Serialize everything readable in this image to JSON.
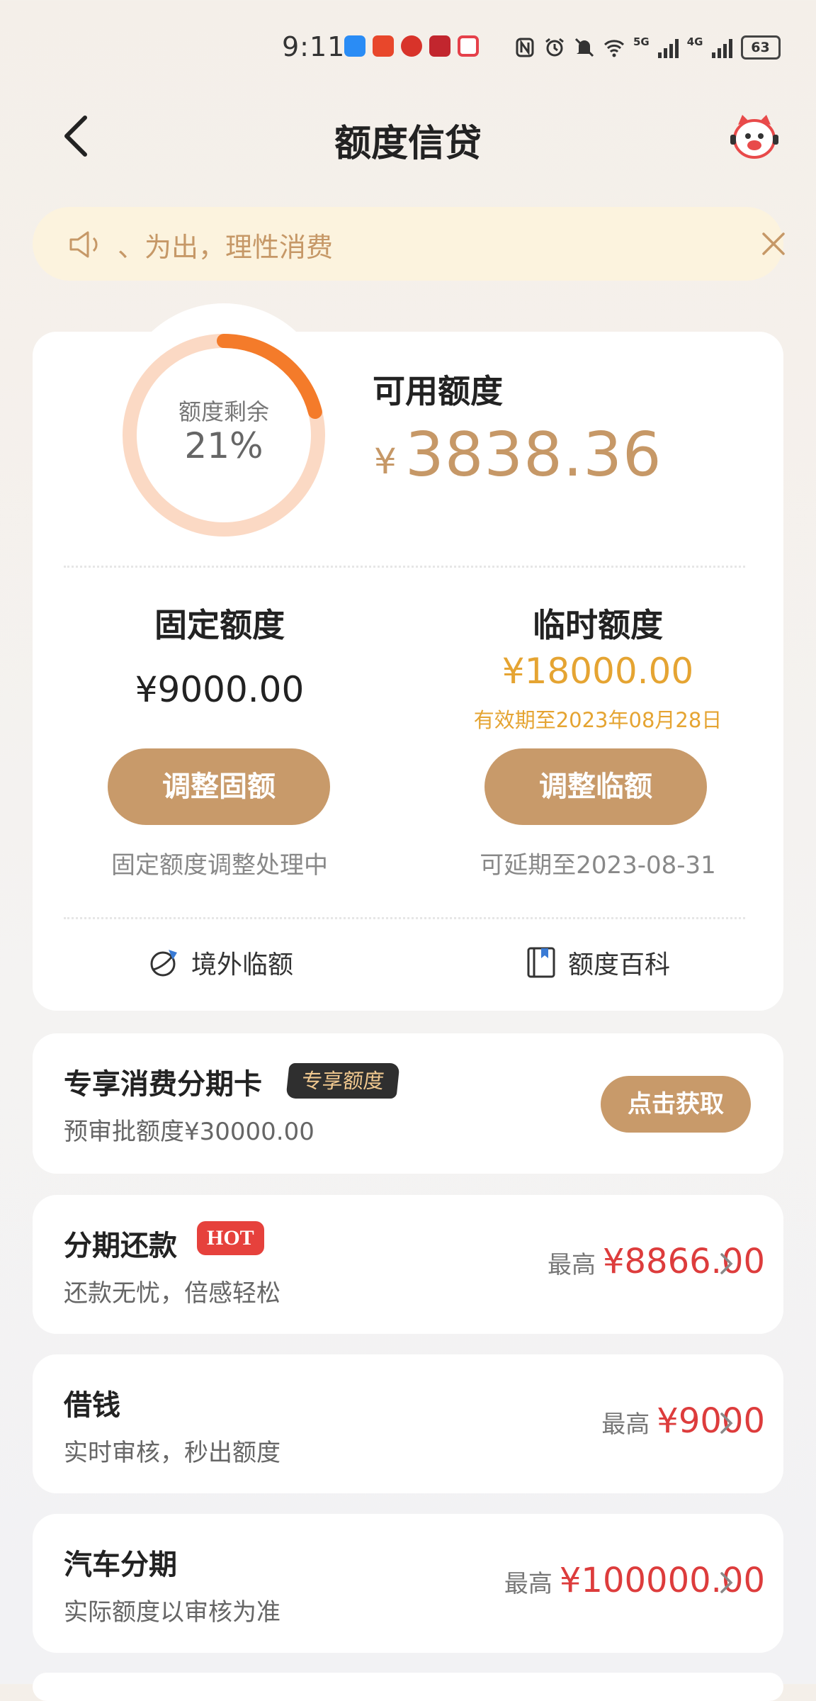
{
  "status_bar": {
    "time": "9:11",
    "network_5g": "5G",
    "network_4g": "4G",
    "battery": "63",
    "app_icon_colors": [
      "#2a8cf5",
      "#e8472b",
      "#d8332a",
      "#c2262e",
      "#e5404a"
    ]
  },
  "header": {
    "title": "额度信贷",
    "back_icon": "chevron-left-icon",
    "service_icon": "mascot-service-icon"
  },
  "notice": {
    "text": "、为出，理性消费",
    "icon": "speaker-icon",
    "close_icon": "close-icon"
  },
  "credit": {
    "ring_label": "额度剩余",
    "ring_value": "21%",
    "ring_fraction": 0.21,
    "available_label": "可用额度",
    "currency": "¥",
    "available_amount": "3838.36",
    "fixed": {
      "title": "固定额度",
      "amount": "¥9000.00",
      "button": "调整固额",
      "note": "固定额度调整处理中"
    },
    "temporary": {
      "title": "临时额度",
      "amount": "¥18000.00",
      "valid": "有效期至2023年08月28日",
      "button": "调整临额",
      "note": "可延期至2023-08-31"
    },
    "links": [
      {
        "label": "境外临额",
        "icon": "globe-plane-icon"
      },
      {
        "label": "额度百科",
        "icon": "book-icon"
      }
    ]
  },
  "promo": {
    "title": "专享消费分期卡",
    "badge": "专享额度",
    "subtitle": "预审批额度¥30000.00",
    "button": "点击获取"
  },
  "products": [
    {
      "title": "分期还款",
      "badge": "HOT",
      "subtitle": "还款无忧，倍感轻松",
      "max_label": "最高",
      "amount": "¥8866.00"
    },
    {
      "title": "借钱",
      "subtitle": "实时审核，秒出额度",
      "max_label": "最高",
      "amount": "¥9000"
    },
    {
      "title": "汽车分期",
      "subtitle": "实际额度以审核为准",
      "max_label": "最高",
      "amount": "¥100000.00"
    }
  ],
  "colors": {
    "accent_gold": "#c89a6a",
    "amount_gold": "#c69867",
    "temp_orange": "#e5a432",
    "ring_track": "#fbd9c4",
    "ring_fill": "#f47b2a",
    "red": "#dd3c3c"
  }
}
